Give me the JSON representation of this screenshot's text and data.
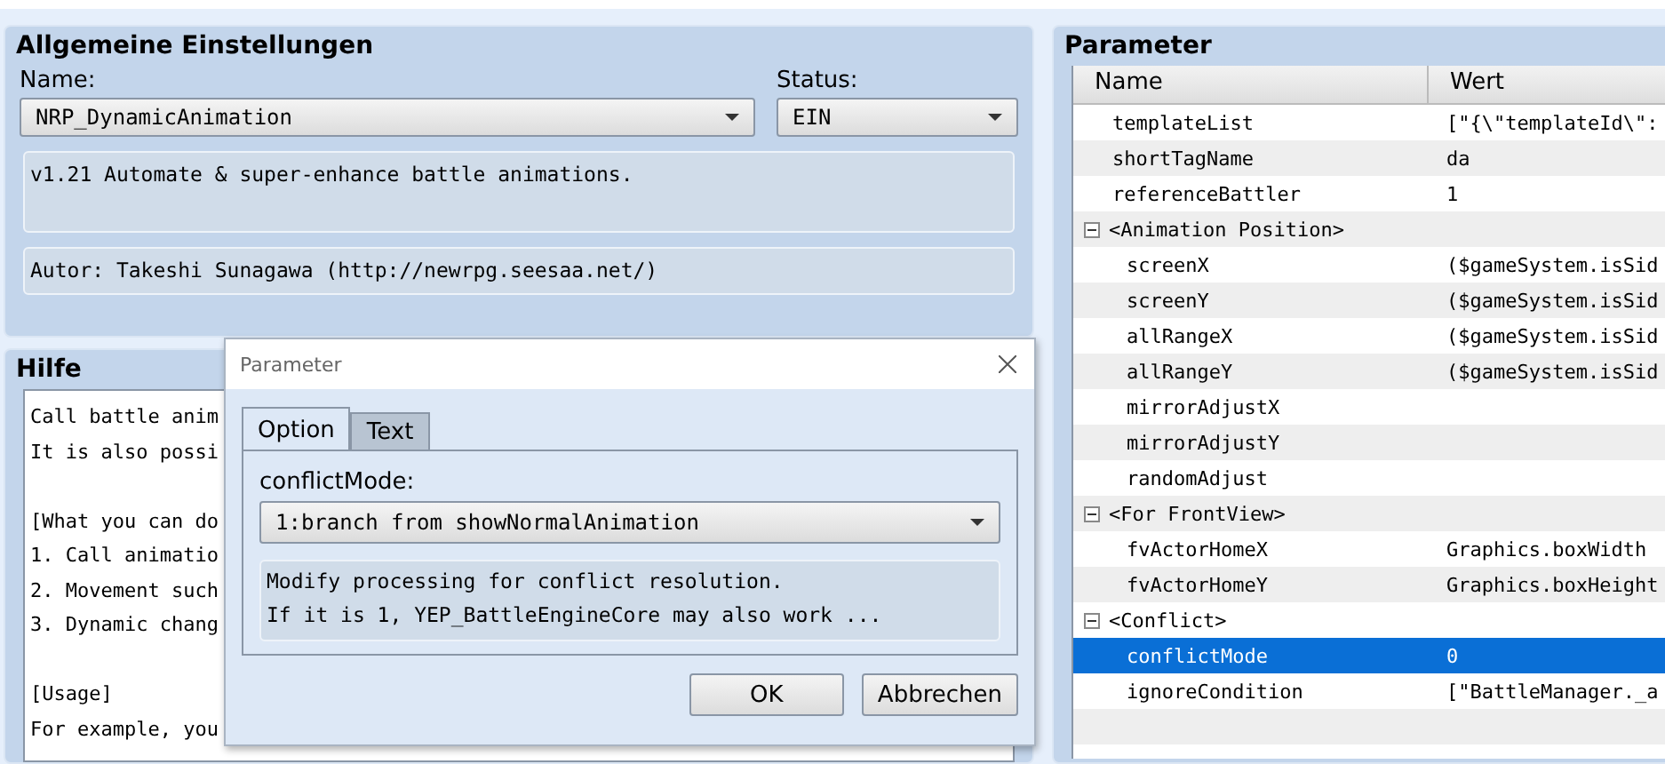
{
  "general": {
    "title": "Allgemeine Einstellungen",
    "name_label": "Name:",
    "name_value": "NRP_DynamicAnimation",
    "status_label": "Status:",
    "status_value": "EIN",
    "description": "v1.21 Automate & super-enhance battle animations.",
    "author": "Autor: Takeshi Sunagawa (http://newrpg.seesaa.net/)"
  },
  "help": {
    "title": "Hilfe",
    "paragraphs": [
      [
        "Call battle anim",
        "It is also possi"
      ],
      [
        "[What you can do",
        "1. Call animatio",
        "2. Movement such",
        "3. Dynamic chang"
      ],
      [
        "[Usage]",
        "For example, you"
      ]
    ]
  },
  "parameters": {
    "title": "Parameter",
    "columns": [
      "Name",
      "Wert"
    ],
    "rows": [
      {
        "name": "templateList",
        "value": "[\"{\\\"templateId\\\":",
        "selected": false
      },
      {
        "name": "shortTagName",
        "value": "da",
        "selected": false
      },
      {
        "name": "referenceBattler",
        "value": "1",
        "selected": false
      },
      {
        "name": "<Animation Position>",
        "expanded": true,
        "selected": false,
        "children": [
          {
            "name": "screenX",
            "value": "($gameSystem.isSid",
            "selected": false
          },
          {
            "name": "screenY",
            "value": "($gameSystem.isSid",
            "selected": false
          },
          {
            "name": "allRangeX",
            "value": "($gameSystem.isSid",
            "selected": false
          },
          {
            "name": "allRangeY",
            "value": "($gameSystem.isSid",
            "selected": false
          },
          {
            "name": "mirrorAdjustX",
            "selected": false
          },
          {
            "name": "mirrorAdjustY",
            "selected": false
          },
          {
            "name": "randomAdjust",
            "selected": false
          }
        ]
      },
      {
        "name": "<For FrontView>",
        "expanded": true,
        "selected": false,
        "children": [
          {
            "name": "fvActorHomeX",
            "value": "Graphics.boxWidth",
            "selected": false
          },
          {
            "name": "fvActorHomeY",
            "value": "Graphics.boxHeight",
            "selected": false
          }
        ]
      },
      {
        "name": "<Conflict>",
        "expanded": true,
        "selected": false,
        "children": [
          {
            "name": "conflictMode",
            "value": "0",
            "selected": true
          },
          {
            "name": "ignoreCondition",
            "value": "[\"BattleManager._a",
            "selected": false
          }
        ]
      }
    ]
  },
  "dialog": {
    "title": "Parameter",
    "tabs": [
      {
        "label": "Option",
        "selected": true
      },
      {
        "label": "Text",
        "selected": false
      }
    ],
    "field_label": "conflictMode:",
    "field_value": "1:branch from showNormalAnimation",
    "description": [
      "Modify processing for conflict resolution.",
      "If it is 1, YEP_BattleEngineCore may also work ..."
    ],
    "buttons": [
      "OK",
      "Abbrechen"
    ]
  }
}
